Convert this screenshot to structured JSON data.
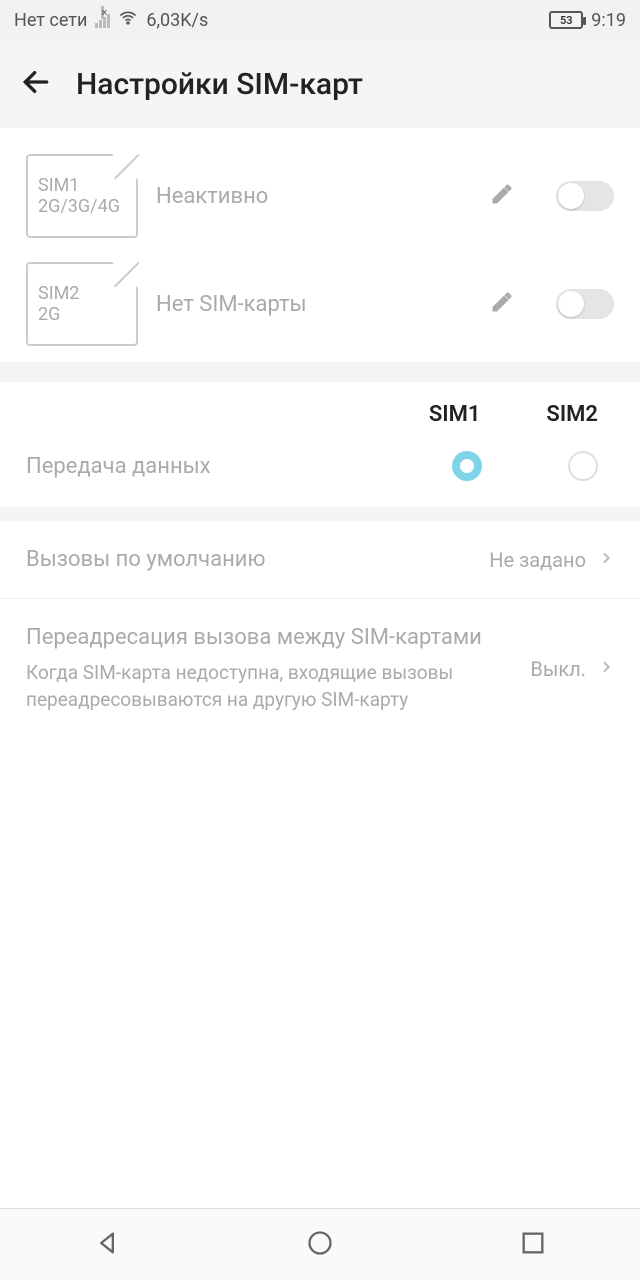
{
  "statusbar": {
    "network": "Нет сети",
    "speed": "6,03K/s",
    "battery": "53",
    "time": "9:19"
  },
  "header": {
    "title": "Настройки SIM-карт"
  },
  "sim1": {
    "name": "SIM1",
    "bands": "2G/3G/4G",
    "status": "Неактивно"
  },
  "sim2": {
    "name": "SIM2",
    "bands": "2G",
    "status": "Нет SIM-карты"
  },
  "radio": {
    "col1": "SIM1",
    "col2": "SIM2",
    "data_label": "Передача данных"
  },
  "default_calls": {
    "label": "Вызовы по умолчанию",
    "value": "Не задано"
  },
  "forwarding": {
    "title": "Переадресация вызова между SIM-картами",
    "desc": "Когда SIM-карта недоступна, входящие вызовы переадресовываются на другую SIM-карту",
    "value": "Выкл."
  }
}
